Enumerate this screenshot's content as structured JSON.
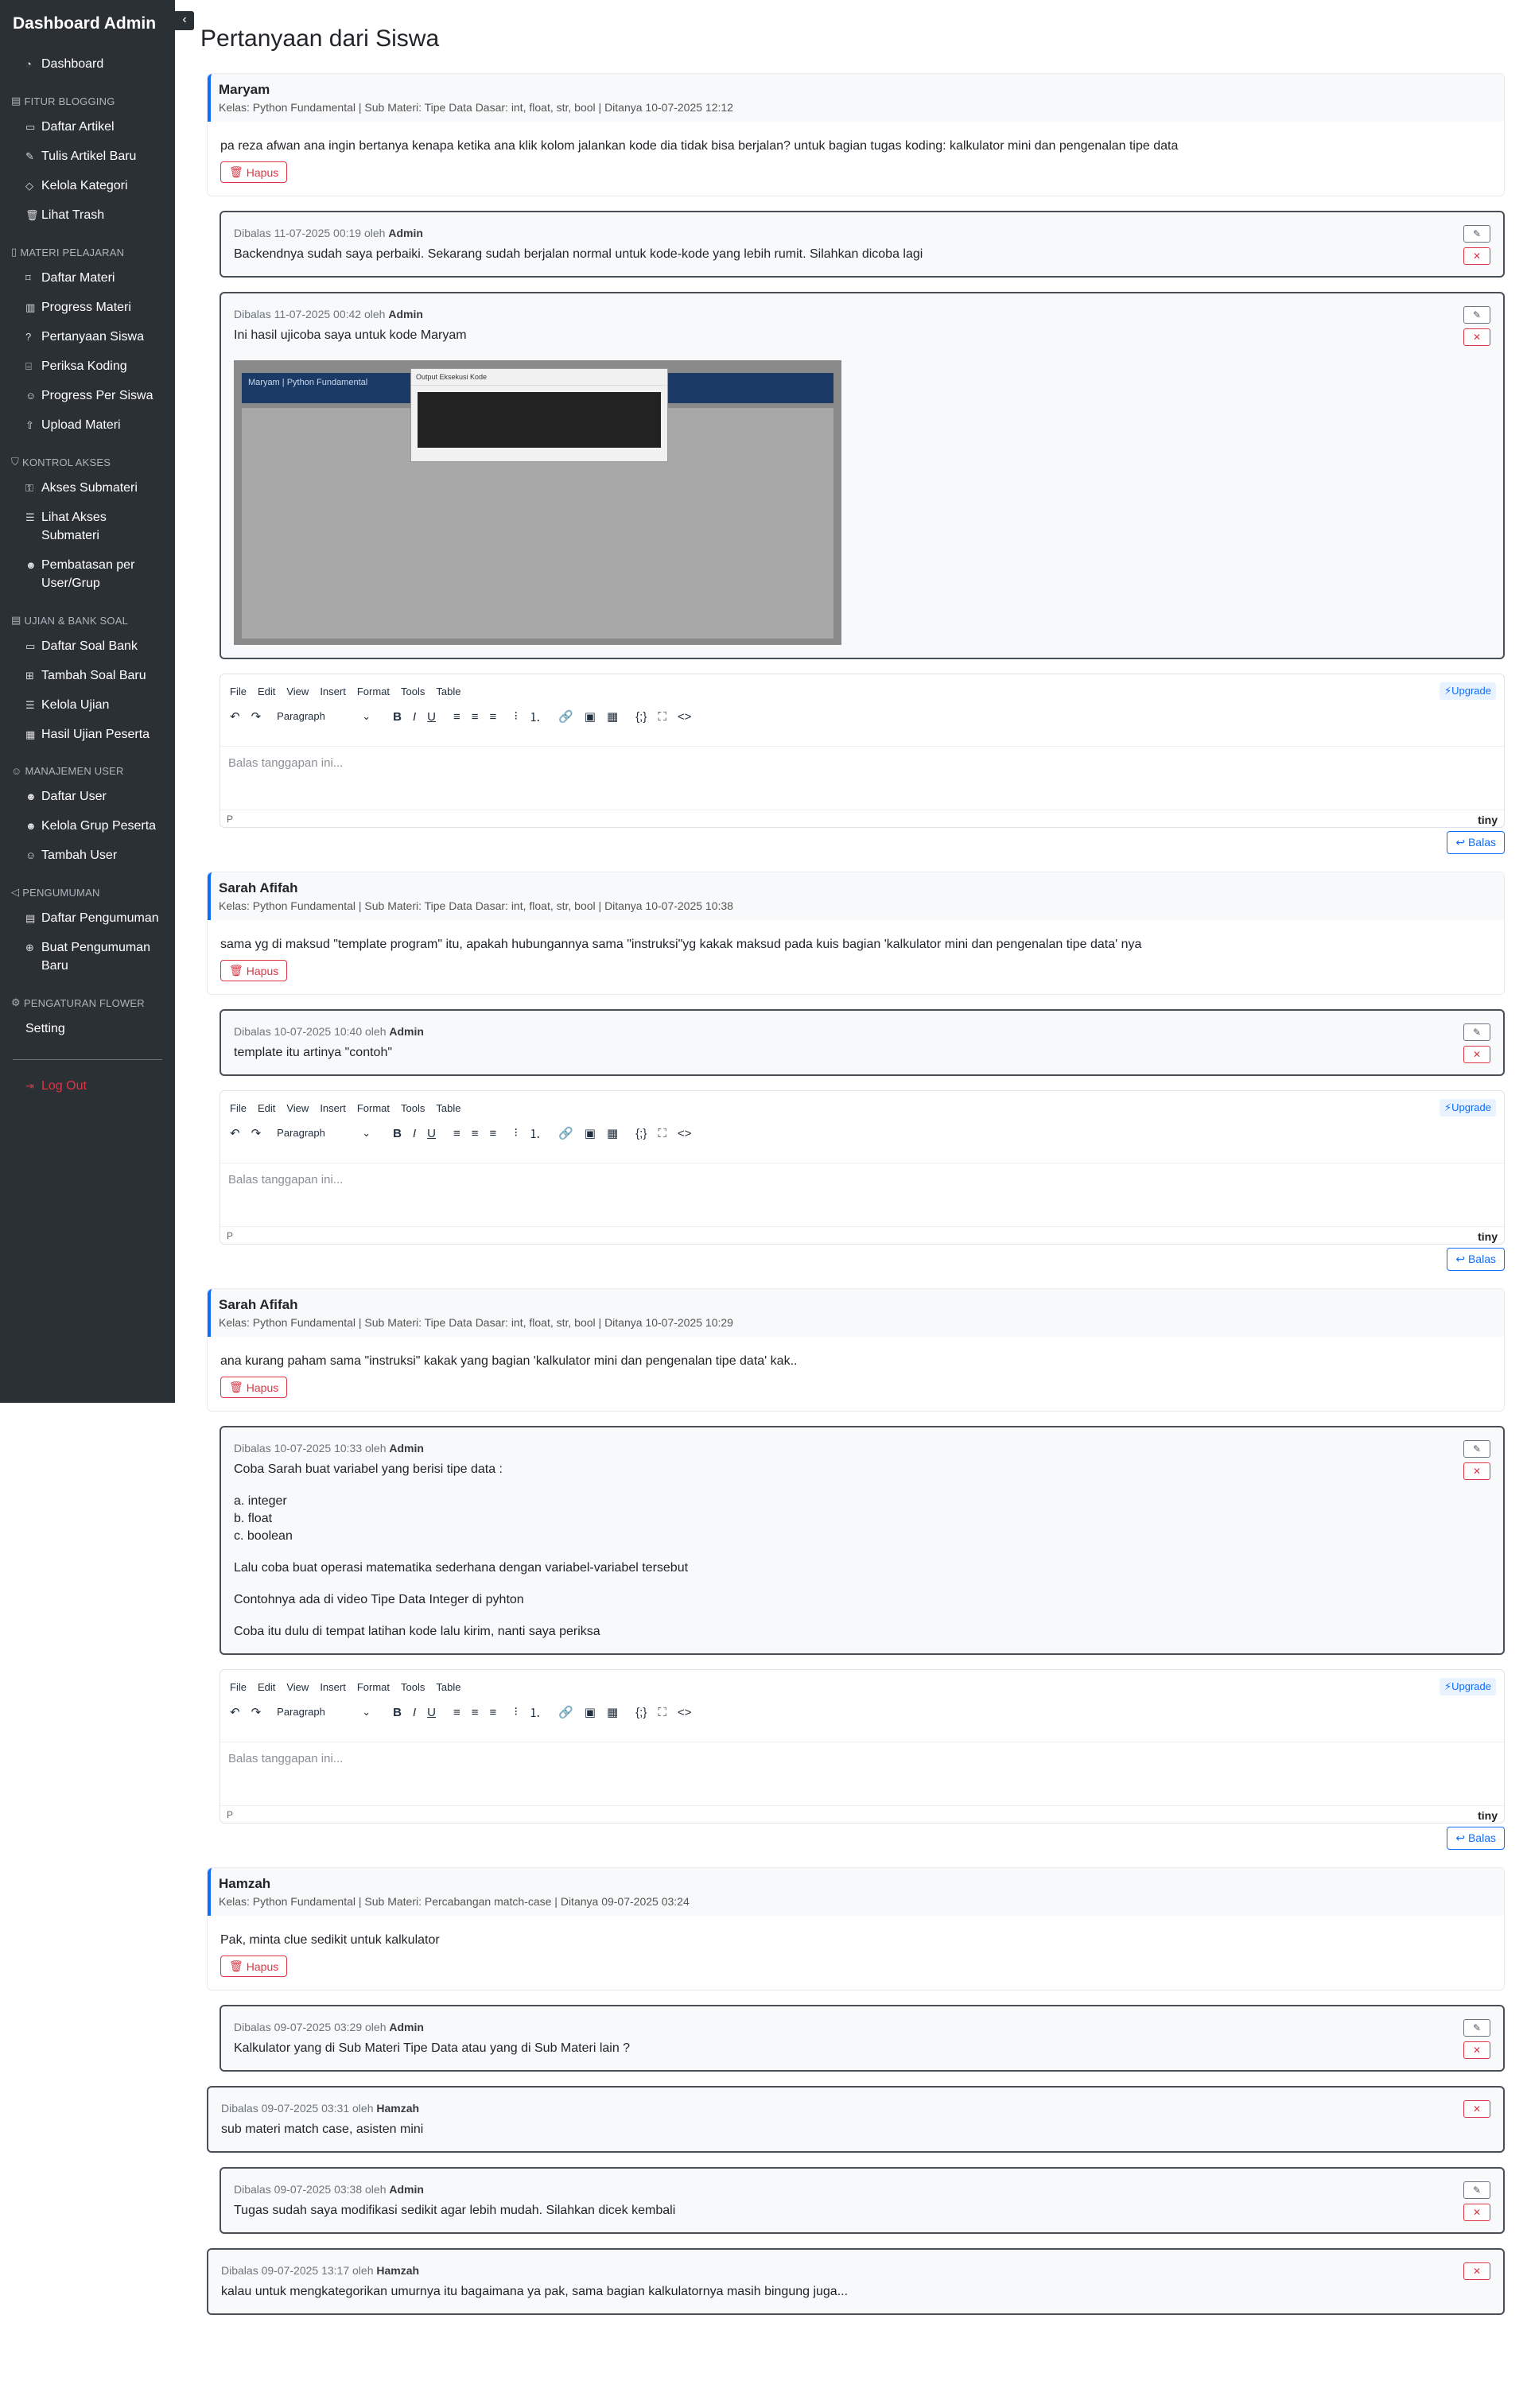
{
  "sidebar": {
    "brand": "Dashboard Admin",
    "dashboard": "Dashboard",
    "sections": [
      {
        "title": "FITUR BLOGGING",
        "items": [
          "Daftar Artikel",
          "Tulis Artikel Baru",
          "Kelola Kategori",
          "Lihat Trash"
        ]
      },
      {
        "title": "MATERI PELAJARAN",
        "items": [
          "Daftar Materi",
          "Progress Materi",
          "Pertanyaan Siswa",
          "Periksa Koding",
          "Progress Per Siswa",
          "Upload Materi"
        ]
      },
      {
        "title": "KONTROL AKSES",
        "items": [
          "Akses Submateri",
          "Lihat Akses Submateri",
          "Pembatasan per User/Grup"
        ]
      },
      {
        "title": "UJIAN & BANK SOAL",
        "items": [
          "Daftar Soal Bank",
          "Tambah Soal Baru",
          "Kelola Ujian",
          "Hasil Ujian Peserta"
        ]
      },
      {
        "title": "MANAJEMEN USER",
        "items": [
          "Daftar User",
          "Kelola Grup Peserta",
          "Tambah User"
        ]
      },
      {
        "title": "PENGUMUMAN",
        "items": [
          "Daftar Pengumuman",
          "Buat Pengumuman Baru"
        ]
      },
      {
        "title": "PENGATURAN FLOWER",
        "items": [
          "Setting"
        ]
      }
    ],
    "logout": "Log Out"
  },
  "page": {
    "title": "Pertanyaan dari Siswa"
  },
  "labels": {
    "hapus": "Hapus",
    "balas": "Balas",
    "upgrade": "⚡Upgrade",
    "placeholder": "Balas tanggapan ini...",
    "paragraph": "Paragraph",
    "statusbar_path": "P",
    "tiny": "tiny",
    "menu": [
      "File",
      "Edit",
      "View",
      "Insert",
      "Format",
      "Tools",
      "Table"
    ]
  },
  "questions": [
    {
      "name": "Maryam",
      "meta": "Kelas: Python Fundamental | Sub Materi: Tipe Data Dasar: int, float, str, bool | Ditanya 10-07-2025 12:12",
      "text": "pa reza afwan ana ingin bertanya kenapa ketika ana klik kolom jalankan kode dia tidak bisa berjalan? untuk bagian tugas koding: kalkulator mini dan pengenalan tipe data",
      "replies": [
        {
          "prefix": "Dibalas 11-07-2025 00:19 oleh",
          "author": "Admin",
          "text": "Backendnya sudah saya perbaiki. Sekarang sudah berjalan normal untuk kode-kode yang lebih rumit. Silahkan dicoba lagi"
        },
        {
          "prefix": "Dibalas 11-07-2025 00:42 oleh",
          "author": "Admin",
          "text": "Ini hasil ujicoba saya untuk kode Maryam",
          "screenshot_title": "Maryam | Python Fundamental",
          "screenshot_modal": "Output Eksekusi Kode"
        }
      ]
    },
    {
      "name": "Sarah Afifah",
      "meta": "Kelas: Python Fundamental | Sub Materi: Tipe Data Dasar: int, float, str, bool | Ditanya 10-07-2025 10:38",
      "text": "sama yg di maksud \"template program\" itu, apakah hubungannya sama \"instruksi\"yg kakak maksud pada kuis bagian 'kalkulator mini dan pengenalan tipe data' nya",
      "replies": [
        {
          "prefix": "Dibalas 10-07-2025 10:40 oleh",
          "author": "Admin",
          "text": "template itu artinya \"contoh\""
        }
      ]
    },
    {
      "name": "Sarah Afifah",
      "meta": "Kelas: Python Fundamental | Sub Materi: Tipe Data Dasar: int, float, str, bool | Ditanya 10-07-2025 10:29",
      "text": "ana kurang paham sama \"instruksi\" kakak yang bagian 'kalkulator mini dan pengenalan tipe data' kak..",
      "replies": [
        {
          "prefix": "Dibalas 10-07-2025 10:33 oleh",
          "author": "Admin",
          "paragraphs": [
            "Coba Sarah buat variabel yang berisi tipe data :",
            "a. integer",
            "b. float",
            "c. boolean",
            "Lalu coba buat operasi matematika sederhana dengan variabel-variabel tersebut",
            "Contohnya ada di video Tipe Data Integer di pyhton",
            "Coba itu dulu di tempat latihan kode lalu kirim, nanti saya periksa"
          ]
        }
      ]
    },
    {
      "name": "Hamzah",
      "meta": "Kelas: Python Fundamental | Sub Materi: Percabangan match-case | Ditanya 09-07-2025 03:24",
      "text": "Pak, minta clue sedikit untuk kalkulator",
      "replies": [
        {
          "prefix": "Dibalas 09-07-2025 03:29 oleh",
          "author": "Admin",
          "text": "Kalkulator yang di Sub Materi Tipe Data atau yang di Sub Materi lain ?"
        },
        {
          "prefix": "Dibalas 09-07-2025 03:31 oleh",
          "author": "Hamzah",
          "text": "sub materi match case, asisten mini"
        },
        {
          "prefix": "Dibalas 09-07-2025 03:38 oleh",
          "author": "Admin",
          "text": "Tugas sudah saya modifikasi sedikit agar lebih mudah. Silahkan dicek kembali"
        },
        {
          "prefix": "Dibalas 09-07-2025 13:17 oleh",
          "author": "Hamzah",
          "text": "kalau untuk mengkategorikan umurnya itu bagaimana ya pak, sama bagian kalkulatornya masih bingung juga..."
        }
      ]
    }
  ]
}
